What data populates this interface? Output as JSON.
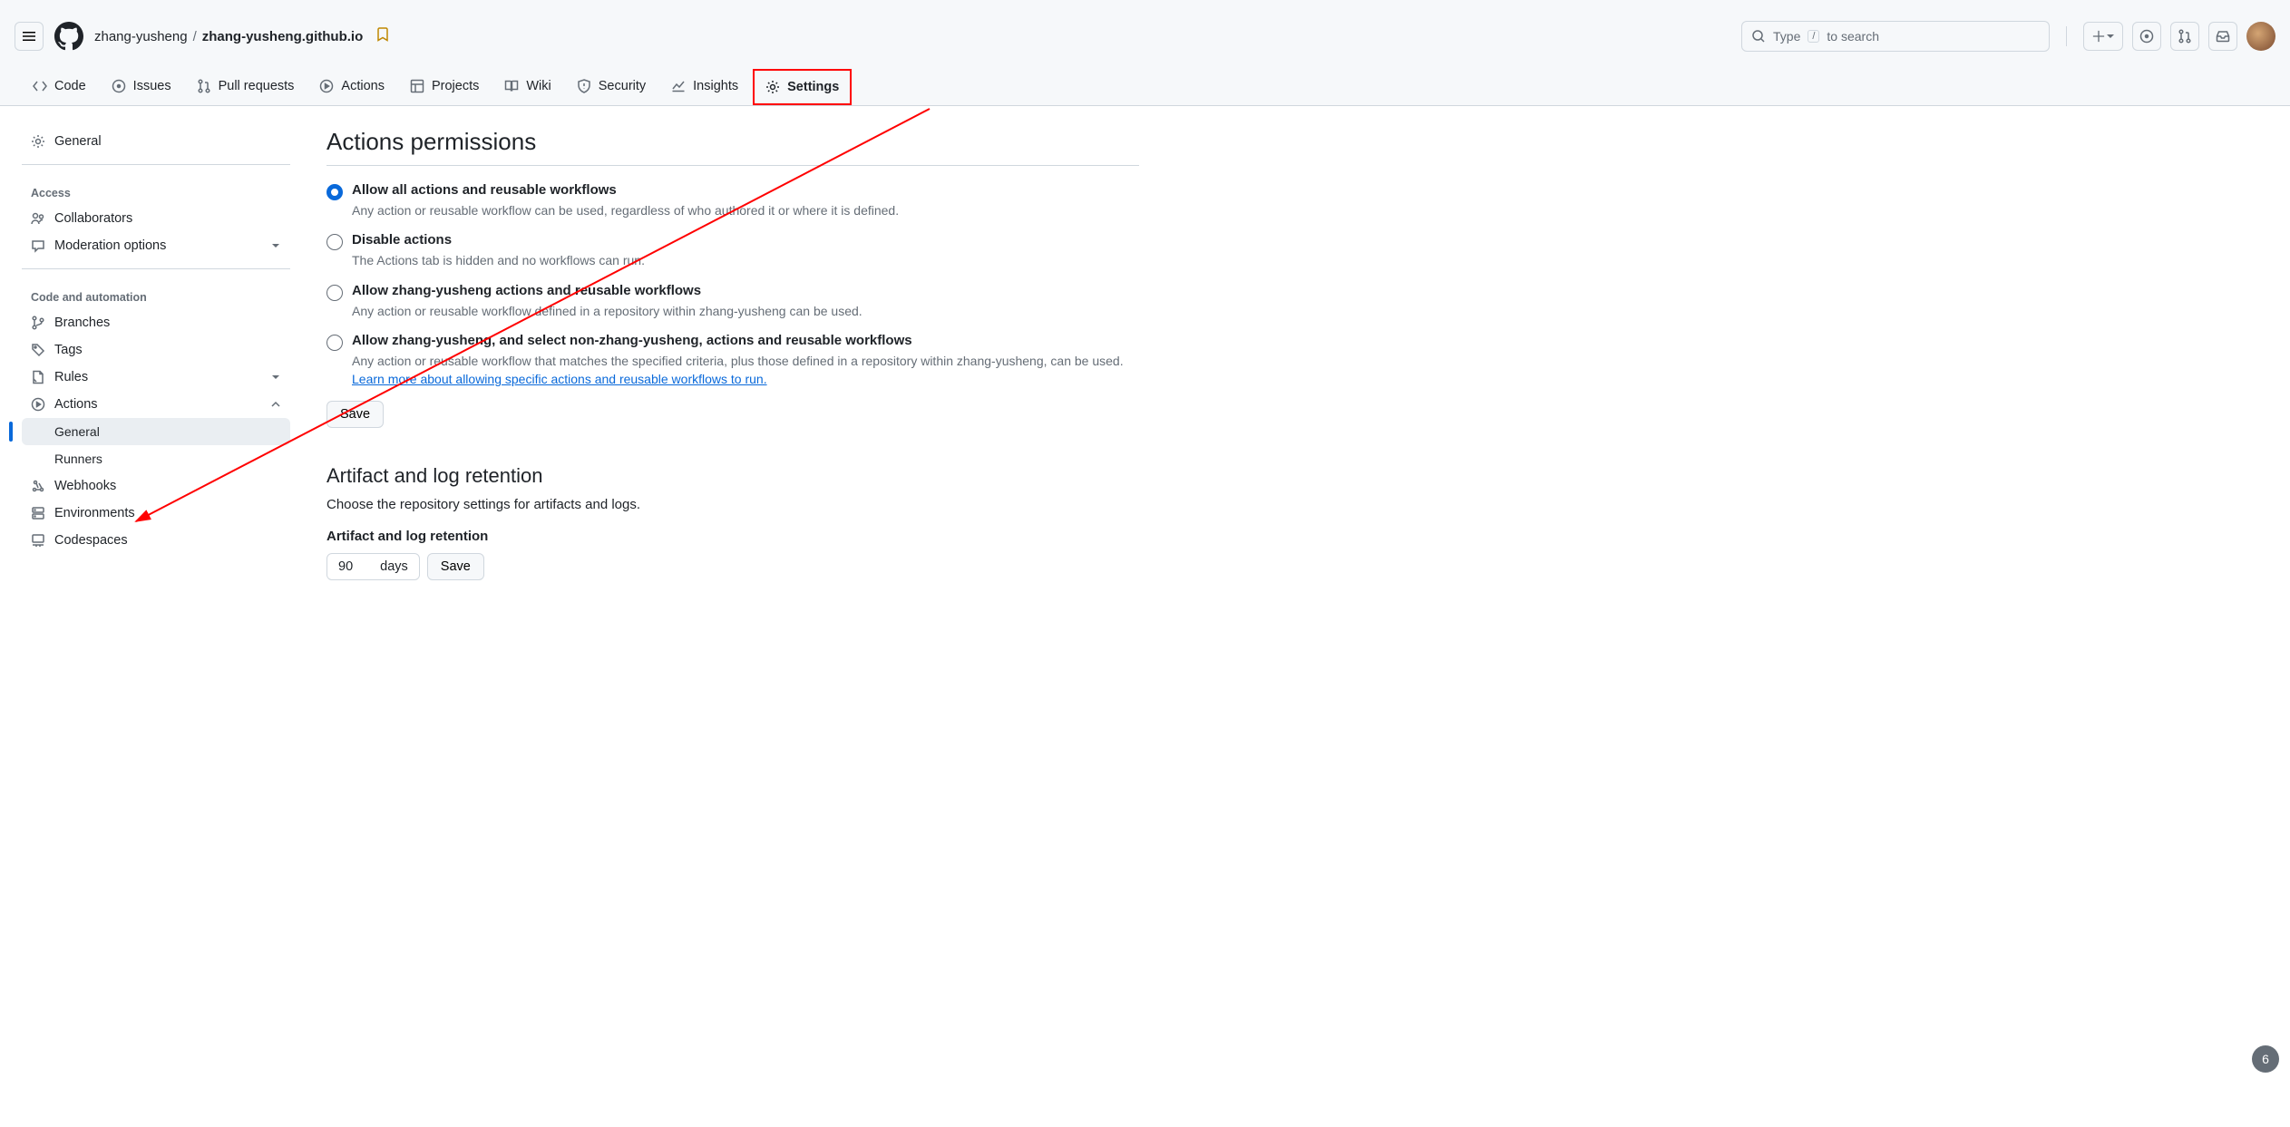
{
  "header": {
    "owner": "zhang-yusheng",
    "repo": "zhang-yusheng.github.io",
    "search_placeholder_pre": "Type",
    "search_slash": "/",
    "search_placeholder_post": "to search"
  },
  "repo_nav": [
    {
      "label": "Code"
    },
    {
      "label": "Issues"
    },
    {
      "label": "Pull requests"
    },
    {
      "label": "Actions"
    },
    {
      "label": "Projects"
    },
    {
      "label": "Wiki"
    },
    {
      "label": "Security"
    },
    {
      "label": "Insights"
    },
    {
      "label": "Settings"
    }
  ],
  "sidebar": {
    "general": "General",
    "access_label": "Access",
    "access_items": [
      {
        "label": "Collaborators"
      },
      {
        "label": "Moderation options"
      }
    ],
    "auto_label": "Code and automation",
    "auto_items": [
      {
        "label": "Branches"
      },
      {
        "label": "Tags"
      },
      {
        "label": "Rules"
      },
      {
        "label": "Actions"
      },
      {
        "label": "General",
        "sub": true,
        "selected": true
      },
      {
        "label": "Runners",
        "sub": true
      },
      {
        "label": "Webhooks"
      },
      {
        "label": "Environments"
      },
      {
        "label": "Codespaces"
      }
    ]
  },
  "permissions": {
    "title": "Actions permissions",
    "options": [
      {
        "title": "Allow all actions and reusable workflows",
        "desc": "Any action or reusable workflow can be used, regardless of who authored it or where it is defined.",
        "checked": true
      },
      {
        "title": "Disable actions",
        "desc": "The Actions tab is hidden and no workflows can run."
      },
      {
        "title": "Allow zhang-yusheng actions and reusable workflows",
        "desc": "Any action or reusable workflow defined in a repository within zhang-yusheng can be used."
      },
      {
        "title": "Allow zhang-yusheng, and select non-zhang-yusheng, actions and reusable workflows",
        "desc": "Any action or reusable workflow that matches the specified criteria, plus those defined in a repository within zhang-yusheng, can be used.",
        "link": "Learn more about allowing specific actions and reusable workflows to run."
      }
    ],
    "save": "Save"
  },
  "retention": {
    "title": "Artifact and log retention",
    "desc": "Choose the repository settings for artifacts and logs.",
    "field_label": "Artifact and log retention",
    "value": "90",
    "unit": "days",
    "save": "Save"
  },
  "float_badge": "6"
}
